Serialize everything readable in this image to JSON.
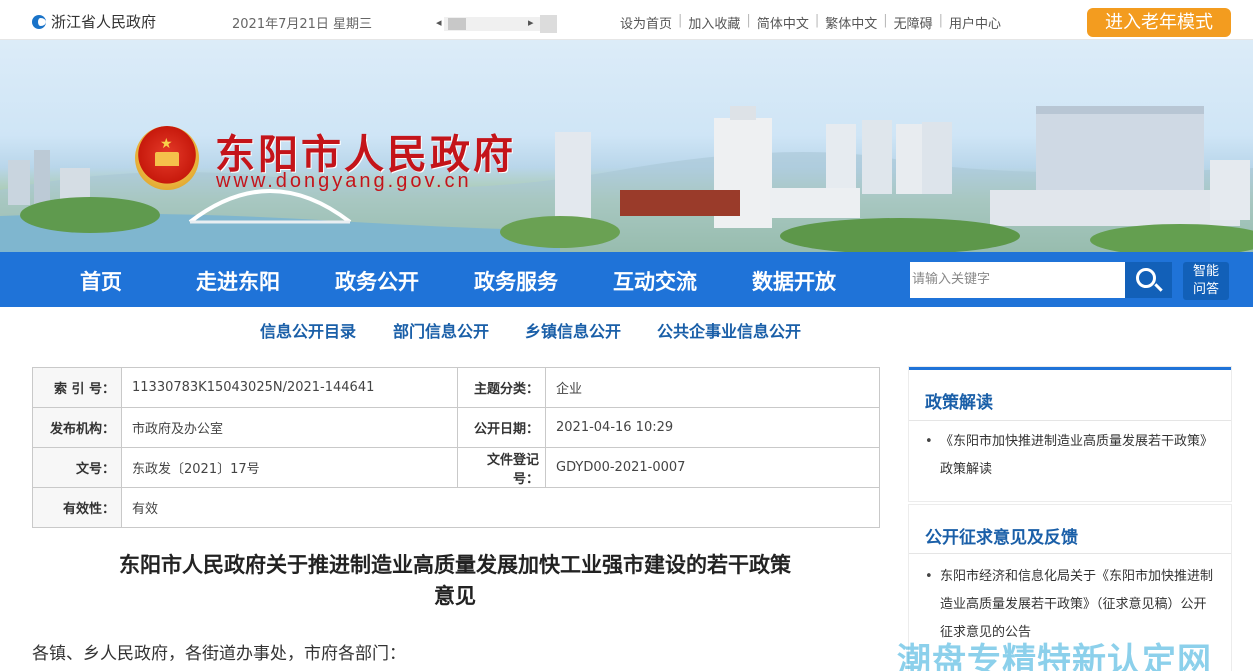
{
  "topbar": {
    "province_link": "浙江省人民政府",
    "date": "2021年7月21日 星期三",
    "links": [
      "设为首页",
      "加入收藏",
      "简体中文",
      "繁体中文",
      "无障碍",
      "用户中心"
    ],
    "elder_mode_label": "进入老年模式"
  },
  "banner": {
    "site_title": "东阳市人民政府",
    "site_url": "www.dongyang.gov.cn"
  },
  "nav": {
    "items": [
      "首页",
      "走进东阳",
      "政务公开",
      "政务服务",
      "互动交流",
      "数据开放"
    ],
    "search_placeholder": "请输入关键字",
    "smart_qa_line1": "智能",
    "smart_qa_line2": "问答"
  },
  "subnav": {
    "items": [
      "信息公开目录",
      "部门信息公开",
      "乡镇信息公开",
      "公共企事业信息公开"
    ]
  },
  "info": {
    "index_label": "索 引 号：",
    "index_value": "11330783K15043025N/2021-144641",
    "topic_label": "主题分类：",
    "topic_value": "企业",
    "issuer_label": "发布机构：",
    "issuer_value": "市政府及办公室",
    "date_label": "公开日期：",
    "date_value": "2021-04-16 10:29",
    "docno_label": "文号：",
    "docno_value": "东政发〔2021〕17号",
    "regno_label": "文件登记号：",
    "regno_value": "GDYD00-2021-0007",
    "validity_label": "有效性：",
    "validity_value": "有效"
  },
  "document": {
    "title_line1": "东阳市人民政府关于推进制造业高质量发展加快工业强市建设的若干政策",
    "title_line2": "意见",
    "salutation": "各镇、乡人民政府，各街道办事处，市府各部门："
  },
  "sidebar": {
    "policy_heading": "政策解读",
    "policy_item": "《东阳市加快推进制造业高质量发展若干政策》政策解读",
    "feedback_heading": "公开征求意见及反馈",
    "feedback_item": "东阳市经济和信息化局关于《东阳市加快推进制造业高质量发展若干政策》（征求意见稿）公开征求意见的公告"
  },
  "watermark": "潮盘专精特新认定网",
  "colors": {
    "nav_blue": "#1f73d8",
    "title_red": "#c4141a",
    "elder_orange": "#f39c1f",
    "link_blue": "#1a5fa8"
  }
}
